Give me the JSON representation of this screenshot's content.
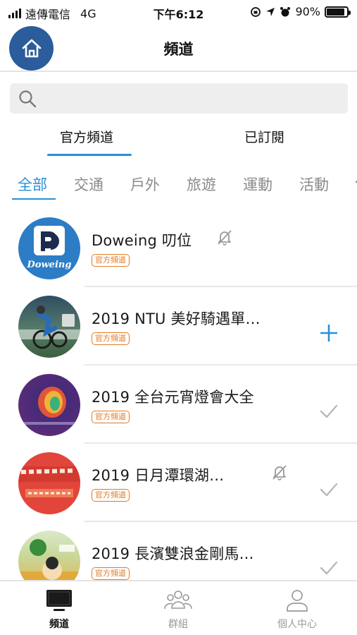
{
  "status_bar": {
    "carrier": "遠傳電信",
    "network": "4G",
    "time": "下午6:12",
    "battery": "90%",
    "battery_level": 0.9
  },
  "header": {
    "title": "頻道",
    "home_icon": "home-icon"
  },
  "search": {
    "placeholder": "",
    "icon": "search-icon"
  },
  "main_tabs": [
    {
      "label": "官方頻道",
      "active": true
    },
    {
      "label": "已訂閱",
      "active": false
    }
  ],
  "categories": [
    {
      "label": "全部",
      "active": true
    },
    {
      "label": "交通",
      "active": false
    },
    {
      "label": "戶外",
      "active": false
    },
    {
      "label": "旅遊",
      "active": false
    },
    {
      "label": "運動",
      "active": false
    },
    {
      "label": "活動",
      "active": false
    }
  ],
  "channels": [
    {
      "name": "Doweing 叨位",
      "badge": "官方頻道",
      "muted": true,
      "action": "none",
      "logo_text": "Doweing"
    },
    {
      "name": "2019 NTU 美好騎遇單…",
      "badge": "官方頻道",
      "muted": false,
      "action": "add"
    },
    {
      "name": "2019 全台元宵燈會大全",
      "badge": "官方頻道",
      "muted": false,
      "action": "subscribed"
    },
    {
      "name": "2019 日月潭環湖…",
      "badge": "官方頻道",
      "muted": true,
      "action": "subscribed"
    },
    {
      "name": "2019 長濱雙浪金剛馬…",
      "badge": "官方頻道",
      "muted": false,
      "action": "subscribed"
    }
  ],
  "tab_bar": [
    {
      "label": "頻道",
      "icon": "tv-icon",
      "active": true
    },
    {
      "label": "群組",
      "icon": "group-icon",
      "active": false
    },
    {
      "label": "個人中心",
      "icon": "person-icon",
      "active": false
    }
  ],
  "colors": {
    "accent": "#2a8fd8",
    "home_button": "#2b5c9c",
    "badge": "#e07b24",
    "inactive_text": "#8b8b8b"
  }
}
